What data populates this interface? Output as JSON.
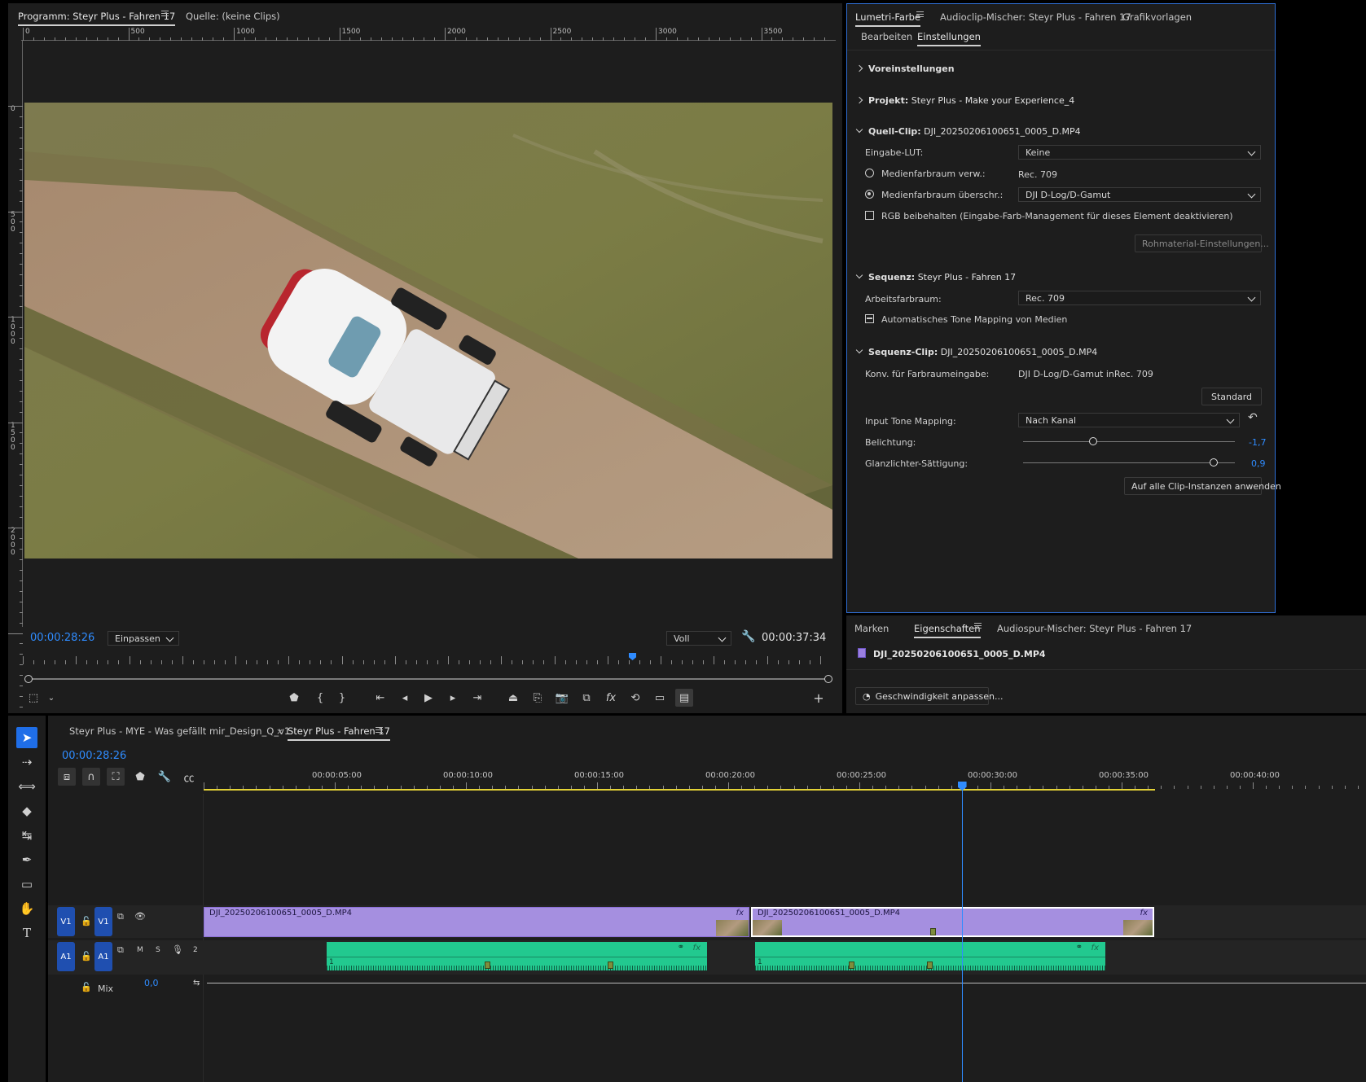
{
  "program_monitor": {
    "tab_program": "Programm: Steyr Plus - Fahren 17",
    "tab_source": "Quelle: (keine Clips)",
    "ruler_labels": [
      "0",
      "500",
      "1000",
      "1500",
      "2000",
      "2500",
      "3000",
      "3500"
    ],
    "vruler_labels": [
      "0",
      "500",
      "1000",
      "1500",
      "2000"
    ],
    "timecode_current": "00:00:28:26",
    "zoom_select": "Einpassen",
    "quality_select": "Voll",
    "timecode_duration": "00:00:37:34"
  },
  "lumetri": {
    "tabs": [
      "Lumetri-Farbe",
      "Audioclip-Mischer: Steyr Plus - Fahren 17",
      "Grafikvorlagen"
    ],
    "subtabs": [
      "Bearbeiten",
      "Einstellungen"
    ],
    "voreinstellungen": "Voreinstellungen",
    "projekt_label": "Projekt:",
    "projekt_value": "Steyr Plus - Make your Experience_4",
    "quellclip_label": "Quell-Clip:",
    "quellclip_value": "DJI_20250206100651_0005_D.MP4",
    "eingabe_lut_label": "Eingabe-LUT:",
    "eingabe_lut_value": "Keine",
    "medien_verw_label": "Medienfarbraum verw.:",
    "medien_verw_value": "Rec. 709",
    "medien_ueberschr_label": "Medienfarbraum überschr.:",
    "medien_ueberschr_value": "DJI D-Log/D-Gamut",
    "rgb_label": "RGB beibehalten (Eingabe-Farb-Management für dieses Element deaktivieren)",
    "rohmaterial_btn": "Rohmaterial-Einstellungen...",
    "sequenz_label": "Sequenz:",
    "sequenz_value": "Steyr Plus - Fahren 17",
    "arbeitsfarbraum_label": "Arbeitsfarbraum:",
    "arbeitsfarbraum_value": "Rec. 709",
    "tonemap_label": "Automatisches Tone Mapping von Medien",
    "seqclip_label": "Sequenz-Clip:",
    "seqclip_value": "DJI_20250206100651_0005_D.MP4",
    "konv_label": "Konv. für Farbraumeingabe:",
    "konv_value": "DJI D-Log/D-Gamut inRec. 709",
    "standard_btn": "Standard",
    "input_tm_label": "Input Tone Mapping:",
    "input_tm_value": "Nach Kanal",
    "belichtung_label": "Belichtung:",
    "belichtung_value": "-1,7",
    "belichtung_pos": 0.33,
    "glanz_label": "Glanzlichter-Sättigung:",
    "glanz_value": "0,9",
    "glanz_pos": 0.9,
    "apply_btn": "Auf alle Clip-Instanzen anwenden"
  },
  "properties": {
    "tabs": [
      "Marken",
      "Eigenschaften",
      "Audiospur-Mischer: Steyr Plus - Fahren 17"
    ],
    "clip_name": "DJI_20250206100651_0005_D.MP4",
    "speed_btn": "Geschwindigkeit anpassen..."
  },
  "timeline": {
    "tabs": [
      "Steyr Plus - MYE - Was gefällt mir_Design_Q_v1",
      "Steyr Plus - Fahren 17"
    ],
    "timecode": "00:00:28:26",
    "ruler_labels": [
      "00:00:05:00",
      "00:00:10:00",
      "00:00:15:00",
      "00:00:20:00",
      "00:00:25:00",
      "00:00:30:00",
      "00:00:35:00",
      "00:00:40:00"
    ],
    "playhead_seconds": 28.9,
    "video_track": {
      "src": "V1",
      "dst": "V1"
    },
    "audio_track": {
      "src": "A1",
      "dst": "A1",
      "m": "M",
      "s": "S",
      "num": "2"
    },
    "mix_label": "Mix",
    "mix_value": "0,0",
    "clip1_name": "DJI_20250206100651_0005_D.MP4",
    "clip2_name": "DJI_20250206100651_0005_D.MP4",
    "fx": "fx",
    "audio_ch": "1"
  },
  "colors": {
    "accent": "#2f8cff",
    "video_clip": "#a58fe0",
    "audio_clip": "#22c98f",
    "work_area": "#e3d236"
  }
}
